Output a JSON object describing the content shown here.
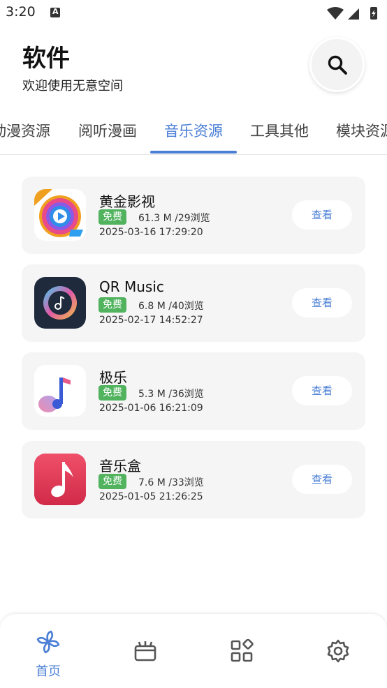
{
  "status_bar": {
    "time": "3:20"
  },
  "header": {
    "title": "软件",
    "subtitle": "欢迎使用无意空间"
  },
  "tabs": [
    {
      "label": "动漫资源"
    },
    {
      "label": "阅听漫画"
    },
    {
      "label": "音乐资源"
    },
    {
      "label": "工具其他"
    },
    {
      "label": "模块资源"
    }
  ],
  "active_tab": "音乐资源",
  "apps": [
    {
      "name": "黄金影视",
      "badge": "免费",
      "meta": "61.3 M /29浏览",
      "date": "2025-03-16 17:29:20",
      "action": "查看",
      "icon": "golden-video-icon"
    },
    {
      "name": "QR Music",
      "badge": "免费",
      "meta": "6.8 M /40浏览",
      "date": "2025-02-17 14:52:27",
      "action": "查看",
      "icon": "qr-music-icon"
    },
    {
      "name": "极乐",
      "badge": "免费",
      "meta": "5.3 M /36浏览",
      "date": "2025-01-06 16:21:09",
      "action": "查看",
      "icon": "jile-icon"
    },
    {
      "name": "音乐盒",
      "badge": "免费",
      "meta": "7.6 M /33浏览",
      "date": "2025-01-05 21:26:25",
      "action": "查看",
      "icon": "music-box-icon"
    }
  ],
  "bottom_nav": {
    "home_label": "首页"
  },
  "colors": {
    "accent": "#4b7fd6",
    "badge": "#52b35f",
    "card_bg": "#f5f5f5"
  }
}
